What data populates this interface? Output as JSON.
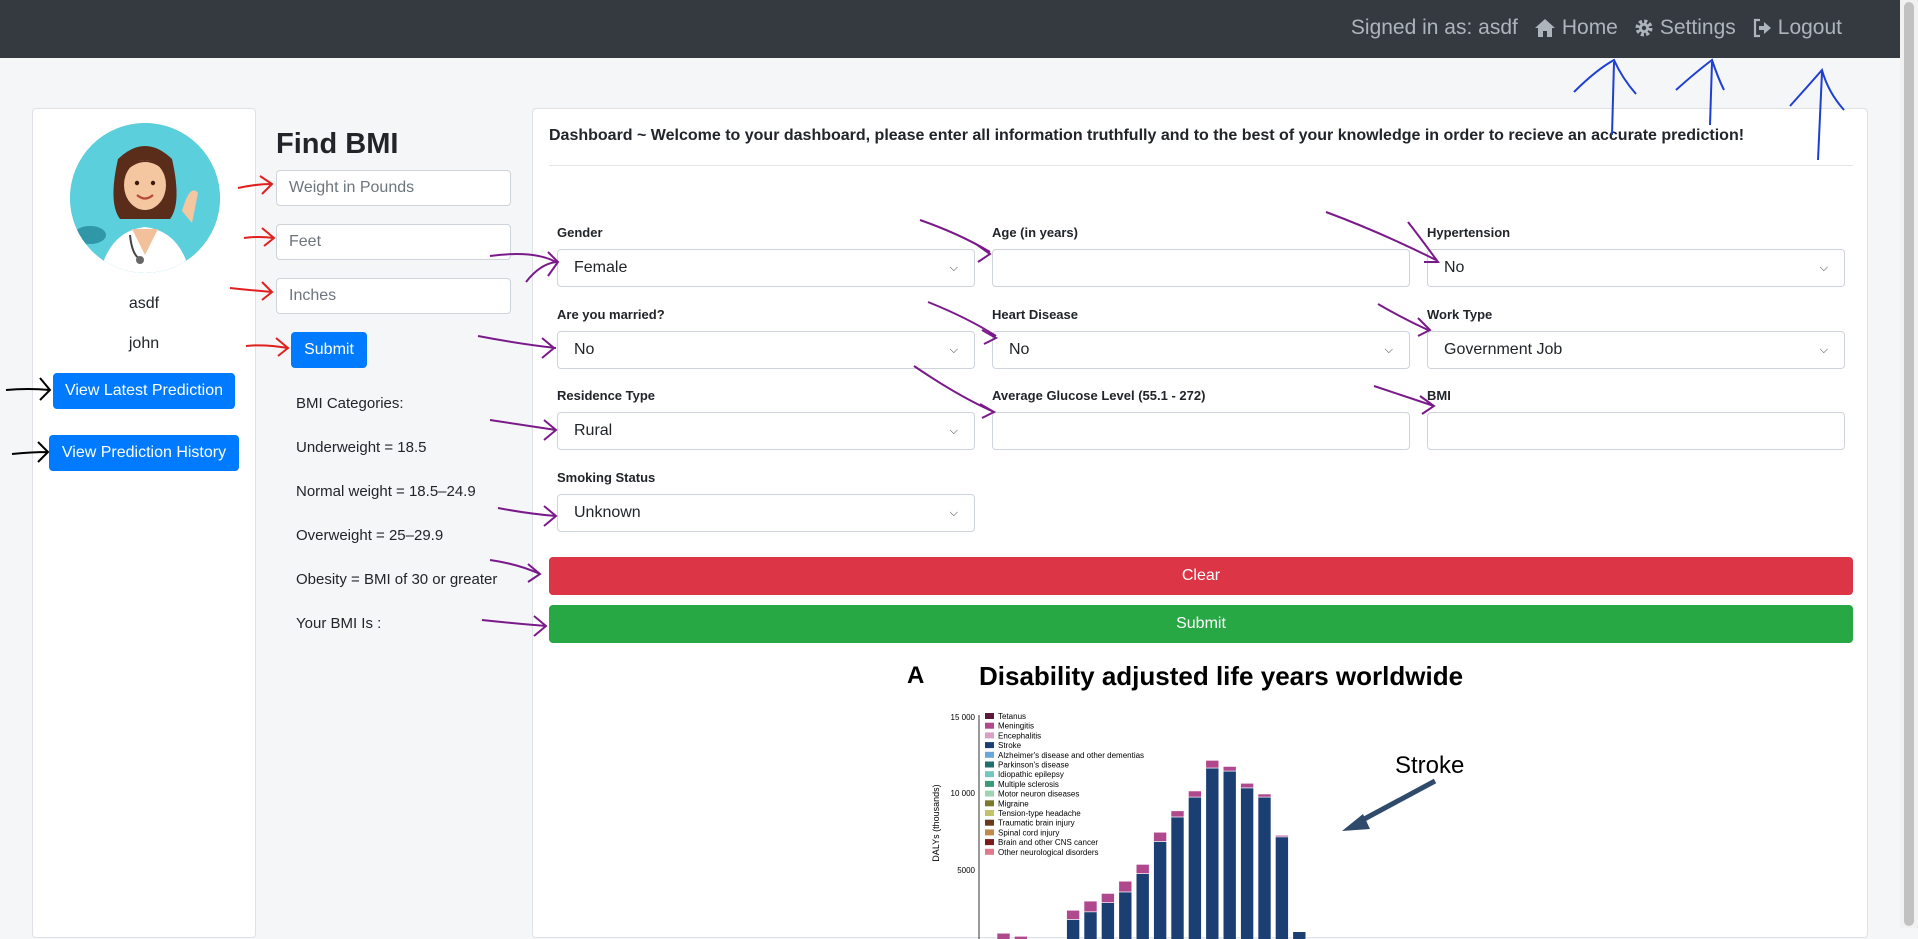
{
  "nav": {
    "signed_in": "Signed in as: asdf",
    "home": "Home",
    "settings": "Settings",
    "logout": "Logout"
  },
  "profile": {
    "username": "asdf",
    "name": "john",
    "latest_button": "View Latest Prediction",
    "history_button": "View Prediction History"
  },
  "bmi": {
    "title": "Find BMI",
    "weight_placeholder": "Weight in Pounds",
    "feet_placeholder": "Feet",
    "inches_placeholder": "Inches",
    "submit": "Submit",
    "categories_title": "BMI Categories:",
    "underweight": "Underweight = 18.5",
    "normal": "Normal weight = 18.5–24.9",
    "overweight": "Overweight = 25–29.9",
    "obesity": "Obesity = BMI of 30 or greater",
    "result": "Your BMI Is :"
  },
  "dashboard": {
    "header": "Dashboard ~ Welcome to your dashboard, please enter all information truthfully and to the best of your knowledge in order to recieve an accurate prediction!",
    "fields": {
      "gender": {
        "label": "Gender",
        "value": "Female"
      },
      "age": {
        "label": "Age (in years)",
        "value": ""
      },
      "hypertension": {
        "label": "Hypertension",
        "value": "No"
      },
      "married": {
        "label": "Are you married?",
        "value": "No"
      },
      "heart": {
        "label": "Heart Disease",
        "value": "No"
      },
      "work": {
        "label": "Work Type",
        "value": "Government Job"
      },
      "residence": {
        "label": "Residence Type",
        "value": "Rural"
      },
      "glucose": {
        "label": "Average Glucose Level (55.1 - 272)",
        "value": ""
      },
      "bmi": {
        "label": "BMI",
        "value": ""
      },
      "smoking": {
        "label": "Smoking Status",
        "value": "Unknown"
      }
    },
    "clear": "Clear",
    "submit": "Submit"
  },
  "figure": {
    "panel_letter": "A",
    "title": "Disability adjusted life years worldwide",
    "annotation": "Stroke",
    "ylabel": "DALYs (thousands)",
    "yticks": [
      "15 000",
      "10 000",
      "5000"
    ],
    "legend": [
      "Tetanus",
      "Meningitis",
      "Encephalitis",
      "Stroke",
      "Alzheimer's disease and other dementias",
      "Parkinson's disease",
      "Idiopathic epilepsy",
      "Multiple sclerosis",
      "Motor neuron diseases",
      "Migraine",
      "Tension-type headache",
      "Traumatic brain injury",
      "Spinal cord injury",
      "Brain and other CNS cancer",
      "Other neurological disorders"
    ],
    "legend_colors": [
      "#5a1a3a",
      "#b0488e",
      "#d9a0c8",
      "#1b3f73",
      "#6aa7d6",
      "#1f6e6e",
      "#74c6c0",
      "#3a9a78",
      "#9ed4b4",
      "#7a7a2a",
      "#c2c26a",
      "#6a3a1a",
      "#c08a4a",
      "#7a1a1a",
      "#e07a8a"
    ],
    "bars_stroke": [
      0,
      0,
      0,
      0,
      1800,
      2300,
      2900,
      3600,
      4800,
      6900,
      8500,
      9800,
      11700,
      11500,
      10400,
      9800,
      7200,
      1000
    ],
    "bars_other": [
      900,
      700,
      0,
      0,
      600,
      700,
      600,
      700,
      600,
      600,
      400,
      400,
      500,
      300,
      300,
      200,
      100,
      0
    ]
  }
}
